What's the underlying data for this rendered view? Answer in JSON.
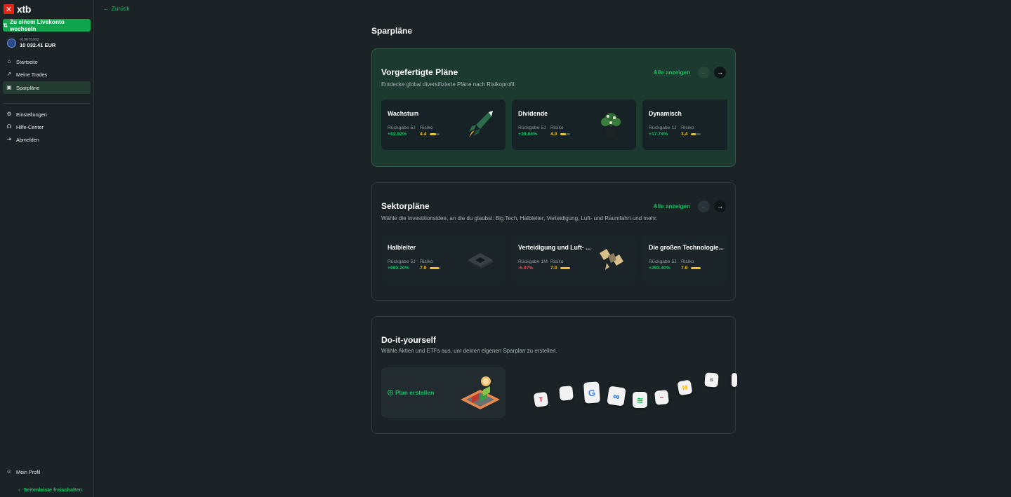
{
  "sidebar": {
    "logo_text": "xtb",
    "live_button": "Zu einem Livekonto wechseln",
    "account": {
      "number": "#19675200",
      "balance": "10 032.41 EUR"
    },
    "nav": [
      {
        "label": "Startseite",
        "icon": "home-icon"
      },
      {
        "label": "Meine Trades",
        "icon": "chart-icon"
      },
      {
        "label": "Sparpläne",
        "icon": "plan-icon",
        "active": true
      }
    ],
    "nav2": [
      {
        "label": "Einstellungen",
        "icon": "gear-icon"
      },
      {
        "label": "Hilfe-Center",
        "icon": "headset-icon"
      },
      {
        "label": "Abmelden",
        "icon": "logout-icon"
      }
    ],
    "profile": "Mein Profil",
    "unlock": "Seitenleiste freischalten"
  },
  "main": {
    "back": "Zurück",
    "title": "Sparpläne",
    "show_all": "Alle anzeigen",
    "prebuilt": {
      "title": "Vorgefertigte Pläne",
      "subtitle": "Entdecke global diversifizierte Pläne nach Risikoprofil.",
      "cards": [
        {
          "name": "Wachstum",
          "return_label": "Rückgabe 5J",
          "return": "+82.92%",
          "risk_label": "Risiko",
          "risk": "4.4",
          "risk_fraction": 0.63,
          "trend": "pos"
        },
        {
          "name": "Dividende",
          "return_label": "Rückgabe 5J",
          "return": "+39.84%",
          "risk_label": "Risiko",
          "risk": "4.0",
          "risk_fraction": 0.57,
          "trend": "pos"
        },
        {
          "name": "Dynamisch",
          "return_label": "Rückgabe 1J",
          "return": "+17.74%",
          "risk_label": "Risiko",
          "risk": "3.4",
          "risk_fraction": 0.49,
          "trend": "pos"
        }
      ]
    },
    "sector": {
      "title": "Sektorpläne",
      "subtitle": "Wähle die Investitionsidee, an die du glaubst: Big Tech, Halbleiter, Verteidigung, Luft- und Raumfahrt und mehr.",
      "cards": [
        {
          "name": "Halbleiter",
          "return_label": "Rückgabe 5J",
          "return": "+683.20%",
          "risk_label": "Risiko",
          "risk": "7.0",
          "risk_fraction": 1.0,
          "trend": "pos"
        },
        {
          "name": "Verteidigung und Luft- ...",
          "return_label": "Rückgabe 1M",
          "return": "-5.07%",
          "risk_label": "Risiko",
          "risk": "7.0",
          "risk_fraction": 1.0,
          "trend": "neg"
        },
        {
          "name": "Die großen Technologie...",
          "return_label": "Rückgabe 5J",
          "return": "+293.40%",
          "risk_label": "Risiko",
          "risk": "7.0",
          "risk_fraction": 1.0,
          "trend": "pos"
        }
      ]
    },
    "diy": {
      "title": "Do-it-yourself",
      "subtitle": "Wähle Aktien und ETFs aus, um deinen eigenen Sparplan zu erstellen.",
      "create": "Plan erstellen",
      "logos": [
        {
          "name": "tesla-logo",
          "glyph": "T",
          "color": "#e31937"
        },
        {
          "name": "apple-logo",
          "glyph": "",
          "color": "#333333"
        },
        {
          "name": "google-logo",
          "glyph": "G",
          "color": "#4285f4"
        },
        {
          "name": "meta-logo",
          "glyph": "∞",
          "color": "#0866ff"
        },
        {
          "name": "spotify-logo",
          "glyph": "≋",
          "color": "#1db954"
        },
        {
          "name": "brand-logo",
          "glyph": "~",
          "color": "#c8102e"
        },
        {
          "name": "mcdonalds-logo",
          "glyph": "M",
          "color": "#ffbc0d"
        },
        {
          "name": "broker-logo",
          "glyph": "≡",
          "color": "#333333"
        }
      ]
    }
  }
}
